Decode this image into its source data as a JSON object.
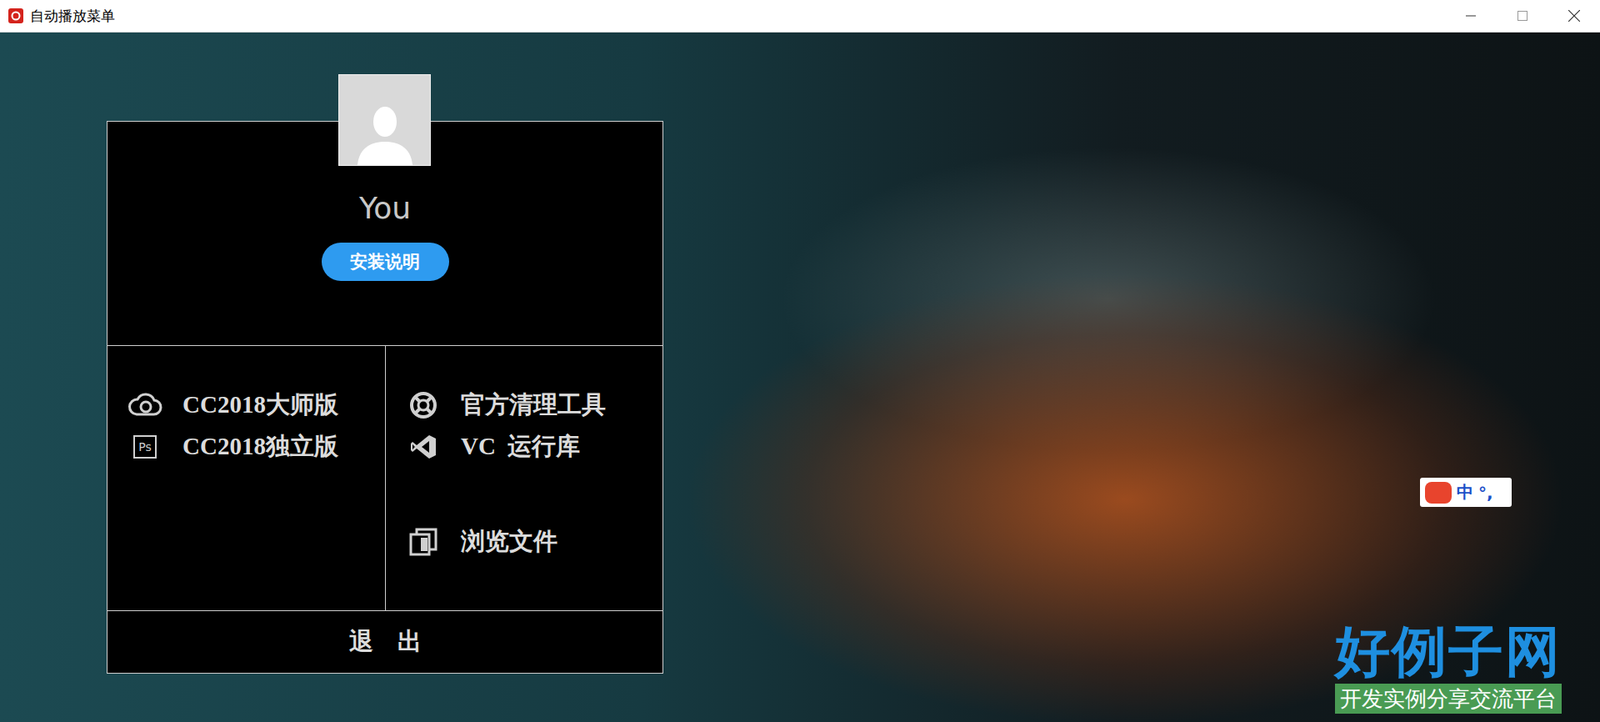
{
  "window": {
    "title": "自动播放菜单"
  },
  "profile": {
    "name": "You",
    "button": "安装说明"
  },
  "left_items": [
    {
      "label": "CC2018大师版",
      "kind": "cloud"
    },
    {
      "label": "CC2018独立版",
      "kind": "ps",
      "icon_text": "Ps"
    }
  ],
  "right_items": [
    {
      "label": "官方清理工具",
      "kind": "lifebuoy"
    },
    {
      "label": "VC  运行库",
      "kind": "vs"
    },
    {
      "label": "浏览文件",
      "kind": "files"
    }
  ],
  "exit": "退    出",
  "ime": {
    "label": "中",
    "punct": "°,"
  },
  "watermark": {
    "title": "好例子网",
    "subtitle": "开发实例分享交流平台"
  }
}
